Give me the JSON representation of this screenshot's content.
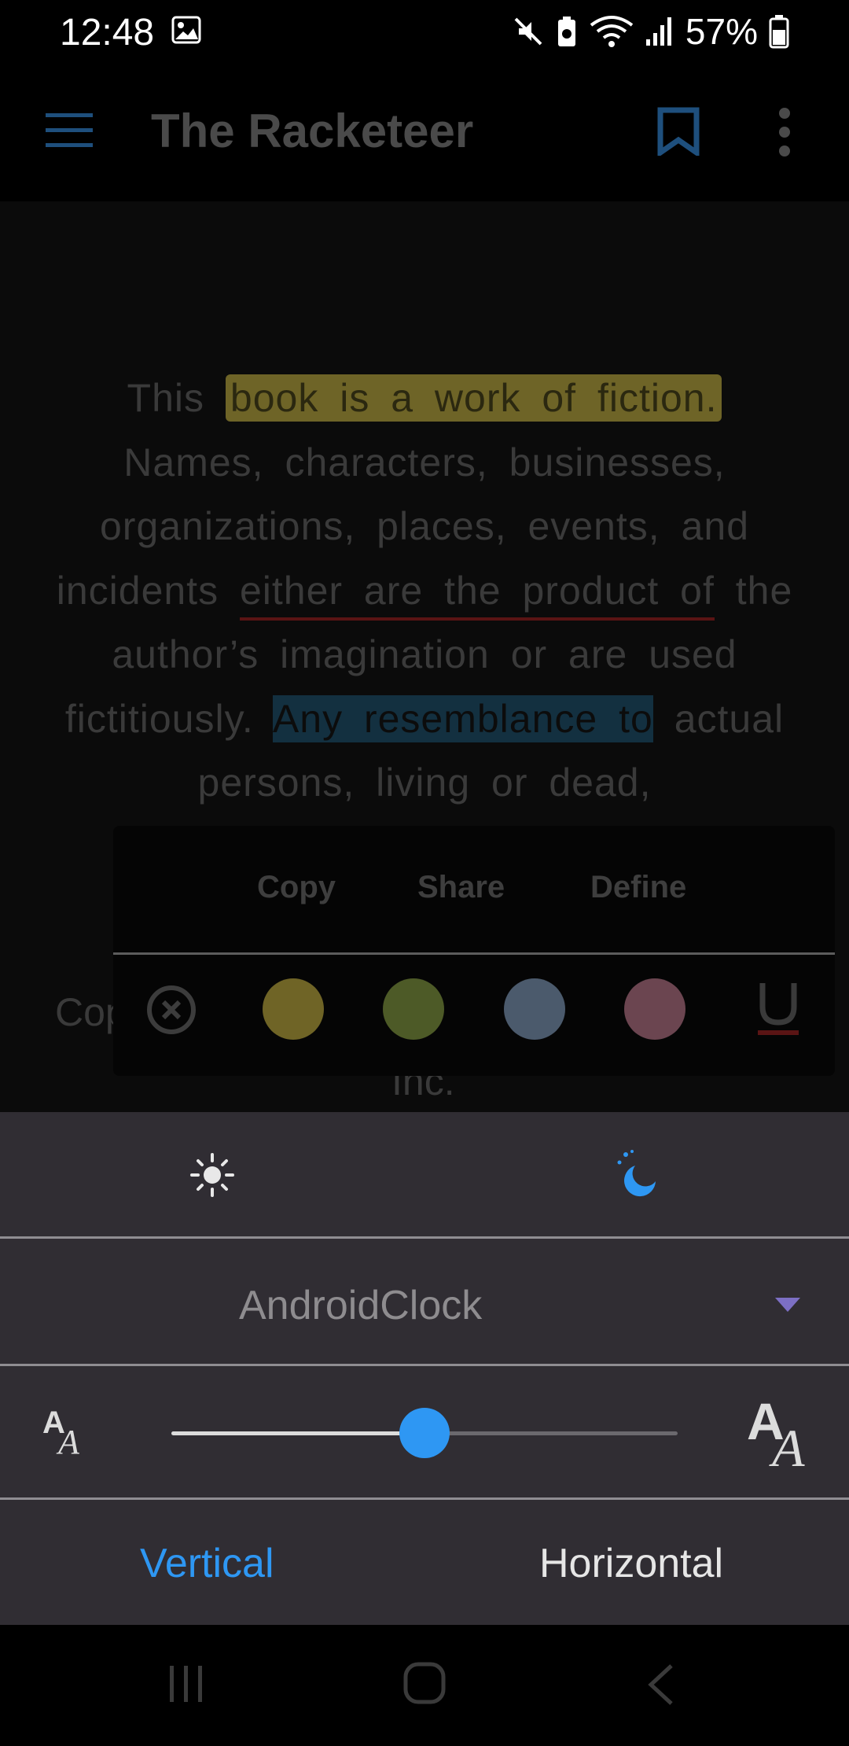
{
  "status_bar": {
    "time": "12:48",
    "battery": "57%",
    "icons": [
      "image-icon",
      "mute-icon",
      "battery-saver-icon",
      "wifi-icon",
      "signal-icon",
      "battery-icon"
    ]
  },
  "toolbar": {
    "title": "The Racketeer",
    "menu_icon": "hamburger-menu-icon",
    "bookmark_icon": "bookmark-icon",
    "more_icon": "more-vertical-icon"
  },
  "reader": {
    "para": {
      "p1": "This ",
      "hl_yellow": "book is a work of fiction.",
      "p2": " Names, characters, businesses, organizations, places, events, and incidents ",
      "ul_red": "either are the product of",
      "p3": " the author’s imagination or are used fictitiously. ",
      "hl_blue": "Any resemblance to",
      "p4": " actual persons, living or dead,"
    },
    "line_partial": "Cop",
    "line_inc": "Inc."
  },
  "selection_popup": {
    "copy": "Copy",
    "share": "Share",
    "define": "Define",
    "colors": [
      "#6f6426",
      "#4d5a27",
      "#4b5a6c",
      "#6b4550"
    ],
    "clear_icon": "clear-highlight-icon",
    "underline_icon": "underline-icon"
  },
  "settings": {
    "theme_light_icon": "sun-icon",
    "theme_dark_icon": "moon-icon",
    "font_name": "AndroidClock",
    "font_size_level": 0.5,
    "mode_vertical": "Vertical",
    "mode_horizontal": "Horizontal",
    "accent": "#2e97f3"
  },
  "nav_bar": {
    "recent_icon": "recent-apps-icon",
    "home_icon": "home-icon",
    "back_icon": "back-icon"
  }
}
